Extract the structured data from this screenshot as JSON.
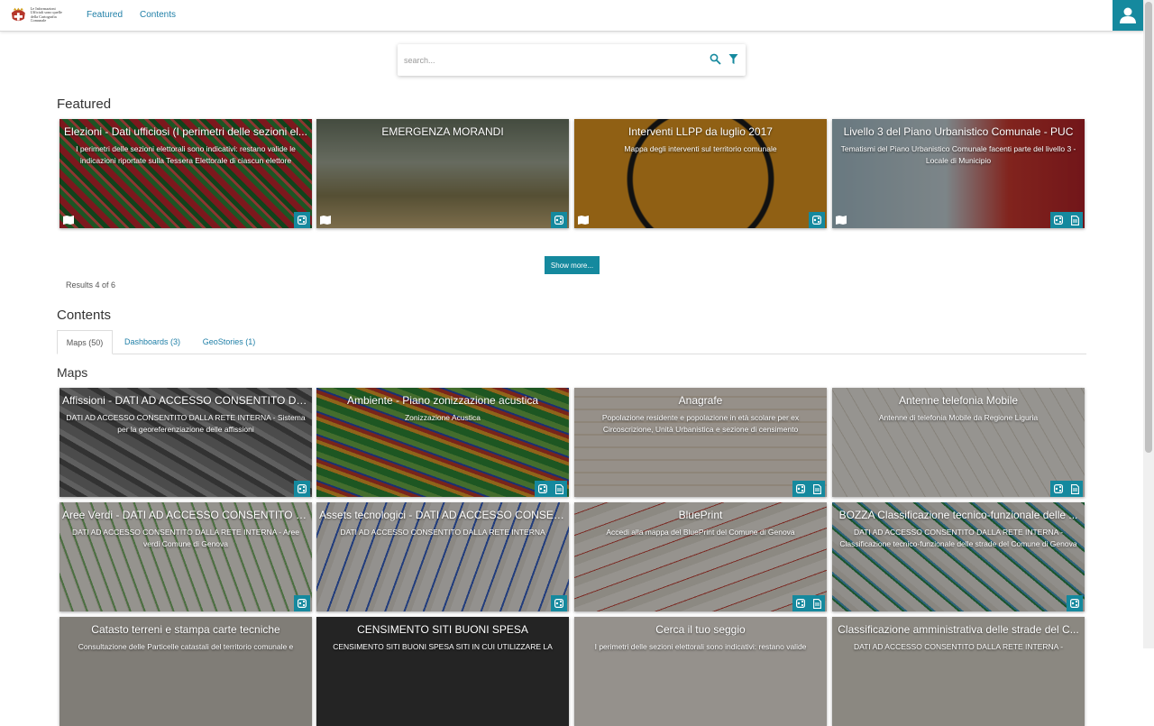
{
  "header": {
    "logo_text": "Le Informazioni\nUfficiali sono quelle\ndella Cartografia\nComunale",
    "nav": [
      "Featured",
      "Contents"
    ]
  },
  "search": {
    "placeholder": "search..."
  },
  "featured": {
    "title": "Featured",
    "show_more": "Show more...",
    "results": "Results 4 of 6",
    "cards": [
      {
        "title": "Elezioni - Dati ufficiosi (I perimetri delle sezioni el...",
        "desc": "I perimetri delle sezioni elettorali sono indicativi: restano valide le indicazioni riportate sulla Tessera Elettorale di ciascun elettore"
      },
      {
        "title": "EMERGENZA MORANDI",
        "desc": ""
      },
      {
        "title": "Interventi LLPP da luglio 2017",
        "desc": "Mappa degli interventi sul territorio comunale"
      },
      {
        "title": "Livello 3 del Piano Urbanistico Comunale - PUC",
        "desc": "Tematismi del Piano Urbanistico Comunale facenti parte del livello 3 - Locale di Municipio"
      }
    ]
  },
  "contents": {
    "title": "Contents",
    "tabs": [
      "Maps (50)",
      "Dashboards (3)",
      "GeoStories (1)"
    ],
    "maps_title": "Maps",
    "cards": [
      {
        "title": "Affissioni - DATI AD ACCESSO CONSENTITO DAL...",
        "desc": "DATI AD ACCESSO CONSENTITO DALLA RETE INTERNA - Sistema per la georeferenziazione delle affissioni"
      },
      {
        "title": "Ambiente - Piano zonizzazione acustica",
        "desc": "Zonizzazione Acustica"
      },
      {
        "title": "Anagrafe",
        "desc": "Popolazione residente e popolazione in età scolare per ex Circoscrizione, Unità Urbanistica e sezione di censimento"
      },
      {
        "title": "Antenne telefonia Mobile",
        "desc": "Antenne di telefonia Mobile da Regione Liguria"
      },
      {
        "title": "Aree Verdi - DATI AD ACCESSO CONSENTITO D...",
        "desc": "DATI AD ACCESSO CONSENTITO DALLA RETE INTERNA - Aree verdi Comune di Genova"
      },
      {
        "title": "Assets tecnologici - DATI AD ACCESSO CONSEN...",
        "desc": "DATI AD ACCESSO CONSENTITO DALLA RETE INTERNA"
      },
      {
        "title": "BluePrint",
        "desc": "Accedi alla mappa del BluePrint del Comune di Genova"
      },
      {
        "title": "BOZZA Classificazione tecnico-funzionale delle ...",
        "desc": "DATI AD ACCESSO CONSENTITO DALLA RETE INTERNA - Classificazione tecnico-funzionale delle strade del Comune di Genova"
      },
      {
        "title": "Catasto terreni e stampa carte tecniche",
        "desc": "Consultazione delle Particelle catastali del territorio comunale e"
      },
      {
        "title": "CENSIMENTO SITI BUONI SPESA",
        "desc": "CENSIMENTO SITI BUONI SPESA SITI IN CUI UTILIZZARE LA"
      },
      {
        "title": "Cerca il tuo seggio",
        "desc": "I perimetri delle sezioni elettorali sono indicativi: restano valide"
      },
      {
        "title": "Classificazione amministrativa delle strade del C...",
        "desc": "DATI AD ACCESSO CONSENTITO DALLA RETE INTERNA -"
      }
    ]
  },
  "colors": {
    "accent": "#15899e",
    "link": "#1f7fa7"
  },
  "icons": [
    "crest-logo-icon",
    "user-icon",
    "search-icon",
    "filter-icon",
    "share-icon",
    "document-icon",
    "map-icon"
  ]
}
